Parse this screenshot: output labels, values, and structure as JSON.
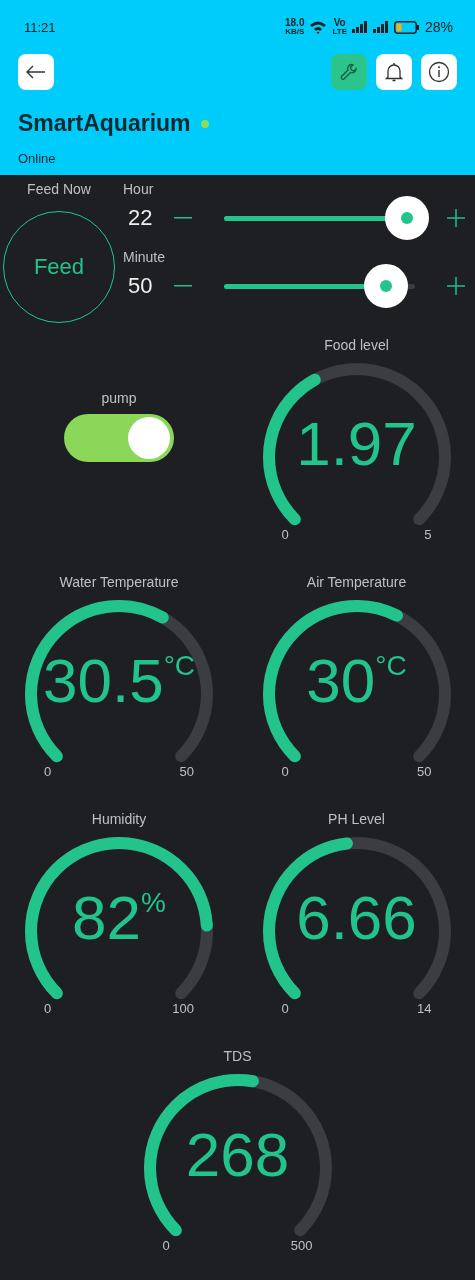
{
  "status_bar": {
    "time": "11:21",
    "speed": "18.0",
    "speed_unit": "KB/S",
    "network": "Vo",
    "network_sub": "LTE",
    "battery_text": "28%"
  },
  "header": {
    "title": "SmartAquarium",
    "online": true,
    "status": "Online",
    "settings_active": true
  },
  "feed": {
    "label": "Feed Now",
    "button": "Feed"
  },
  "timers": [
    {
      "label": "Hour",
      "value": "22",
      "level": 0.96
    },
    {
      "label": "Minute",
      "value": "50",
      "level": 0.85
    }
  ],
  "pump": {
    "label": "pump",
    "on": true
  },
  "gauges": [
    {
      "label": "Food level",
      "value": "1.97",
      "min": "0",
      "max": "5"
    },
    {
      "label": "Water Temperature",
      "value": "30.5",
      "unit": "°C",
      "min": "0",
      "max": "50"
    },
    {
      "label": "Air Temperature",
      "value": "30",
      "unit": "°C",
      "min": "0",
      "max": "50"
    },
    {
      "label": "Humidity",
      "value": "82",
      "unit": "%",
      "min": "0",
      "max": "100"
    },
    {
      "label": "PH Level",
      "value": "6.66",
      "min": "0",
      "max": "14"
    },
    {
      "label": "TDS",
      "value": "268",
      "min": "0",
      "max": "500"
    }
  ]
}
